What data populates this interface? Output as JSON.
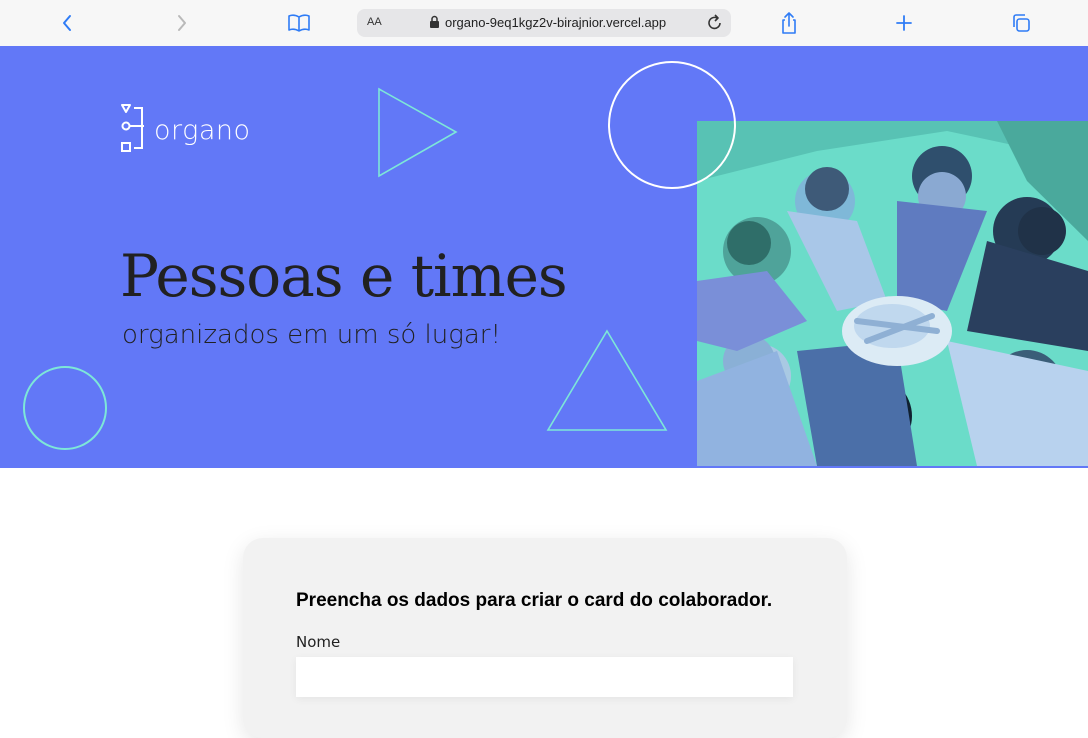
{
  "browser": {
    "text_size_label": "AA",
    "url": "organo-9eq1kgz2v-birajnior.vercel.app",
    "icons": [
      "back-icon",
      "forward-icon",
      "book-icon",
      "lock-icon",
      "reload-icon",
      "share-icon",
      "plus-icon",
      "tabs-icon"
    ],
    "accent_color": "#2f7cf6"
  },
  "banner": {
    "logo_text": "organo",
    "title": "Pessoas e times",
    "subtitle": "organizados em um só lugar!",
    "background_color": "#6278f7",
    "image": "team-hands-photo"
  },
  "form": {
    "heading": "Preencha os dados para criar o card do colaborador.",
    "fields": [
      {
        "label": "Nome",
        "value": "",
        "placeholder": ""
      }
    ]
  }
}
